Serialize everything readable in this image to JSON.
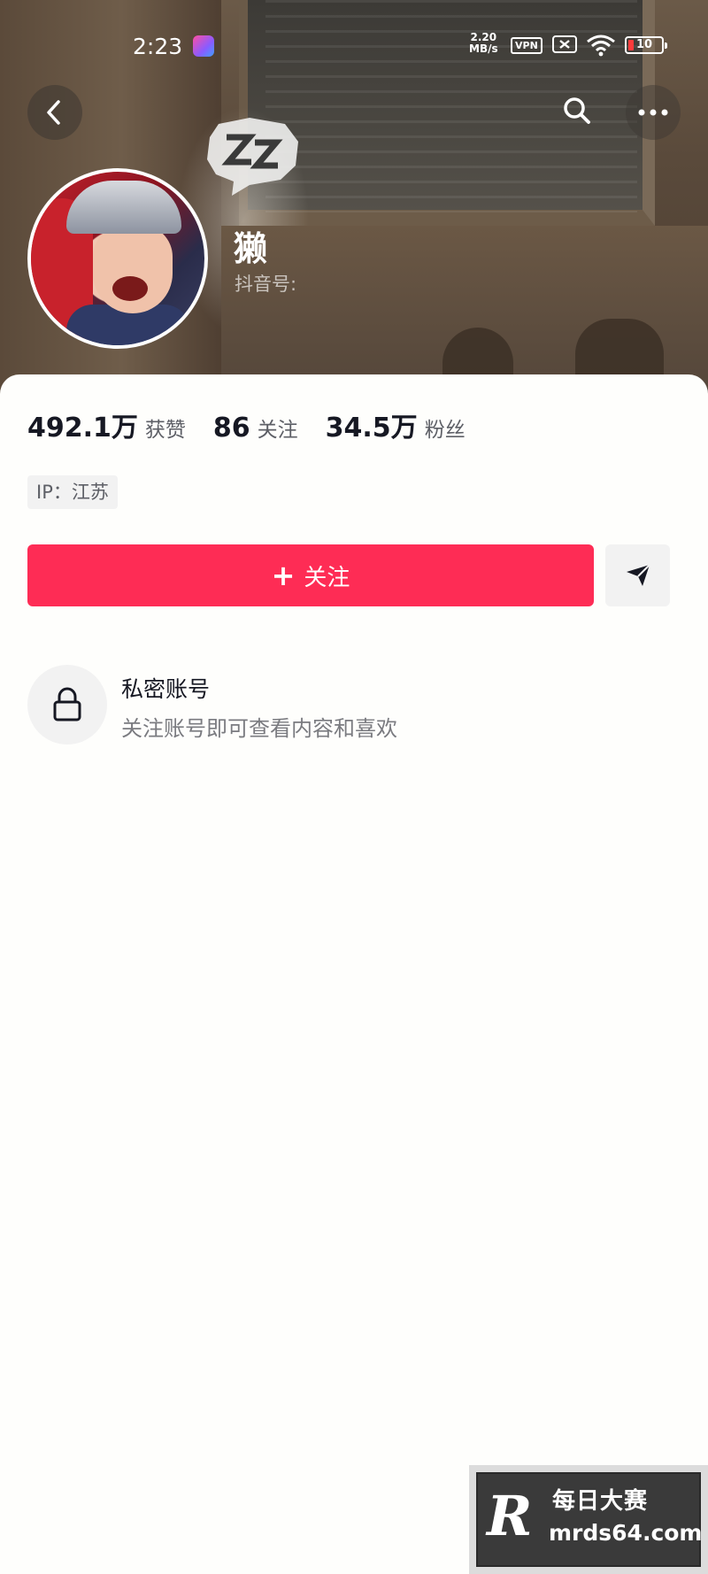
{
  "status_bar": {
    "time": "2:23",
    "network_speed_value": "2.20",
    "network_speed_unit": "MB/s",
    "vpn_label": "VPN",
    "battery_level": "10"
  },
  "profile": {
    "username": "獭",
    "douyin_id_label": "抖音号:",
    "stats": [
      {
        "value": "492.1万",
        "label": "获赞"
      },
      {
        "value": "86",
        "label": "关注"
      },
      {
        "value": "34.5万",
        "label": "粉丝"
      }
    ],
    "ip_location": "IP：江苏"
  },
  "actions": {
    "follow_plus": "+",
    "follow_label": "关注"
  },
  "private_account": {
    "title": "私密账号",
    "description": "关注账号即可查看内容和喜欢"
  },
  "watermark": {
    "logo_letter": "R",
    "name": "每日大赛",
    "url": "mrds64.com"
  },
  "colors": {
    "accent": "#fe2c55",
    "text_primary": "#161823",
    "text_secondary": "#5d5f66",
    "chip_bg": "#f2f2f2"
  },
  "icons": [
    "back-icon",
    "search-icon",
    "more-icon",
    "share-icon",
    "lock-icon",
    "wifi-icon",
    "sim-icon",
    "battery-icon"
  ]
}
